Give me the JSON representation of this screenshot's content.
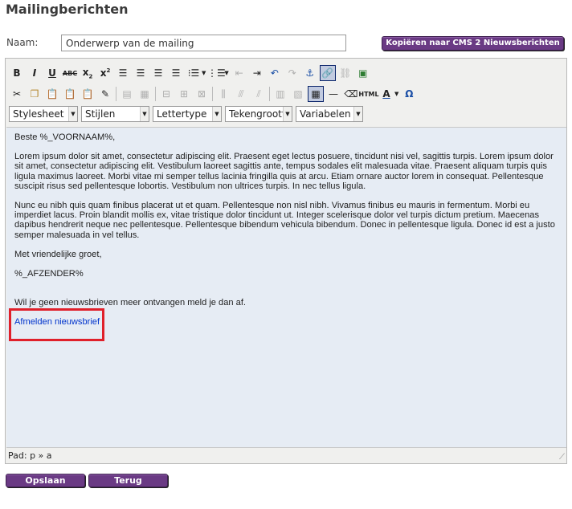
{
  "page": {
    "title": "Mailingberichten"
  },
  "form": {
    "naam_label": "Naam:",
    "naam_value": "Onderwerp van de mailing",
    "copy_button": "Kopiëren naar CMS 2 Nieuwsberichten"
  },
  "toolbar": {
    "row1": [
      "bold-icon",
      "italic-icon",
      "underline-icon",
      "strikethrough-icon",
      "subscript-icon",
      "superscript-icon",
      "align-left-icon",
      "align-center-icon",
      "align-right-icon",
      "align-justify-icon",
      "bullet-list-icon",
      "numbered-list-icon",
      "outdent-icon",
      "indent-icon",
      "undo-icon",
      "redo-icon",
      "anchor-icon",
      "link-icon",
      "unlink-icon",
      "image-icon"
    ],
    "row2": [
      "cut-icon",
      "copy-icon",
      "paste-icon",
      "paste-text-icon",
      "paste-word-icon",
      "cleanup-icon",
      "table-props-icon",
      "delete-table-icon",
      "row-props-icon",
      "insert-row-icon",
      "delete-row-icon",
      "col-props-icon",
      "insert-col-icon",
      "delete-col-icon",
      "merge-cells-icon",
      "split-cells-icon",
      "insert-table-icon",
      "horizontal-rule-icon",
      "remove-format-icon",
      "html-source-icon",
      "text-color-icon",
      "special-char-icon"
    ],
    "selects": [
      {
        "label": "Stylesheet"
      },
      {
        "label": "Stijlen"
      },
      {
        "label": "Lettertype"
      },
      {
        "label": "Tekengrootte"
      },
      {
        "label": "Variabelen"
      }
    ]
  },
  "content": {
    "greeting": "Beste %_VOORNAAM%,",
    "para1": "Lorem ipsum dolor sit amet, consectetur adipiscing elit. Praesent eget lectus posuere, tincidunt nisi vel, sagittis turpis. Lorem ipsum dolor sit amet, consectetur adipiscing elit. Vestibulum laoreet sagittis ante, tempus sodales elit malesuada vitae. Praesent aliquam turpis quis ligula maximus laoreet. Morbi vitae mi semper tellus lacinia fringilla quis at arcu. Etiam ornare auctor lorem in consequat. Pellentesque suscipit risus sed pellentesque lobortis. Vestibulum non ultrices turpis. In nec tellus ligula.",
    "para2": "Nunc eu nibh quis quam finibus placerat ut et quam. Pellentesque non nisl nibh. Vivamus finibus eu mauris in fermentum. Morbi eu imperdiet lacus. Proin blandit mollis ex, vitae tristique dolor tincidunt ut. Integer scelerisque dolor vel turpis dictum pretium. Maecenas dapibus hendrerit neque nec pellentesque. Pellentesque bibendum vehicula bibendum. Donec in pellentesque ligula. Donec id est a justo semper malesuada in vel tellus.",
    "closing": "Met vriendelijke groet,",
    "sender": "%_AFZENDER%",
    "unsubscribe_text": "Wil je geen nieuwsbrieven meer ontvangen meld je dan af.",
    "unsubscribe_link": "Afmelden nieuwsbrief"
  },
  "status": {
    "path": "Pad: p » a",
    "grip": "⟋"
  },
  "actions": {
    "save": "Opslaan",
    "back": "Terug"
  },
  "colors": {
    "button_purple": "#6a3a84",
    "editor_bg": "#e6ecf4",
    "highlight": "#e0202a",
    "link": "#0033cc"
  }
}
